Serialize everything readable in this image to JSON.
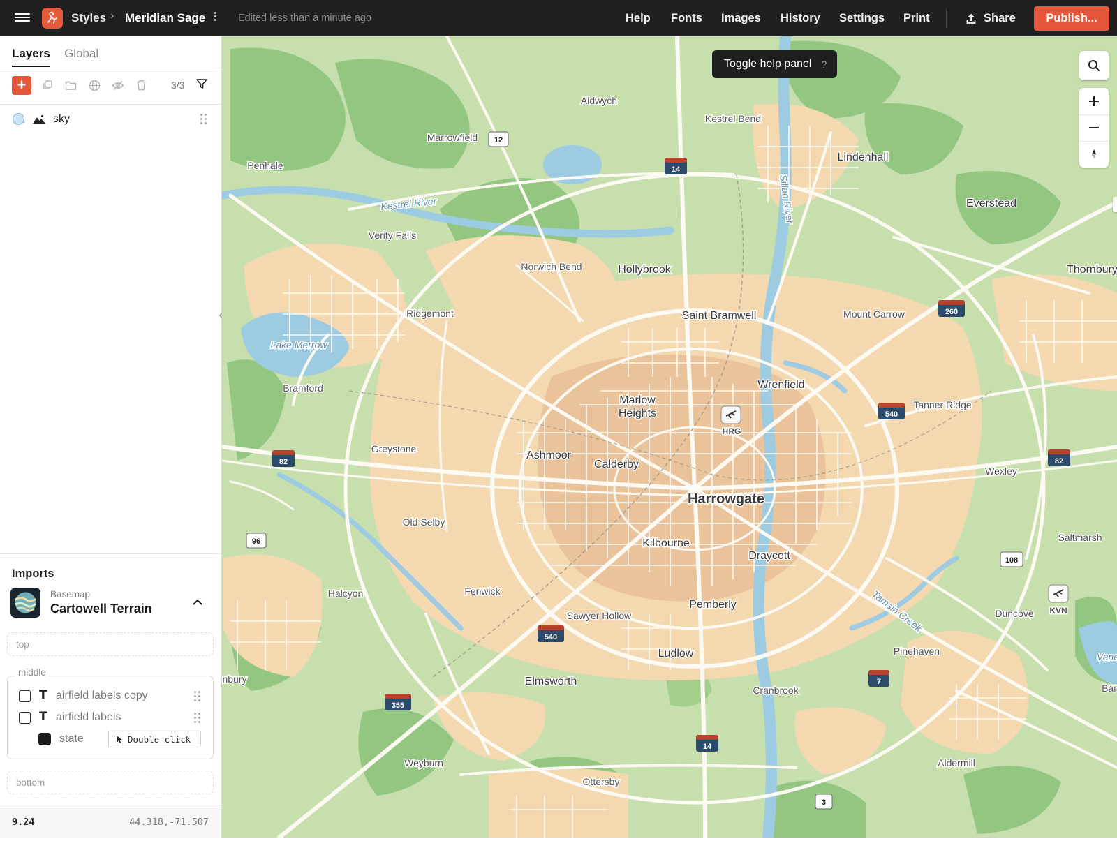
{
  "app": {
    "breadcrumb_root": "Styles",
    "style_name": "Meridian Sage",
    "edited_status": "Edited less than a minute ago",
    "accent_color": "#e4573a"
  },
  "nav": {
    "help": "Help",
    "fonts": "Fonts",
    "images": "Images",
    "history": "History",
    "settings": "Settings",
    "print": "Print",
    "share": "Share",
    "publish": "Publish..."
  },
  "sidebar": {
    "tabs": {
      "layers": "Layers",
      "global": "Global"
    },
    "active_tab": "Layers",
    "layer_count": "3/3",
    "layers": [
      {
        "name": "sky",
        "type_icon": "mountain-icon",
        "swatch_color": "#c8e4f4"
      }
    ],
    "imports": {
      "title": "Imports",
      "basemap_kicker": "Basemap",
      "basemap_name": "Cartowell Terrain",
      "slot_top": "top",
      "slot_middle": "middle",
      "slot_bottom": "bottom",
      "middle_layers": [
        {
          "name": "airfield labels copy",
          "type": "symbol"
        },
        {
          "name": "airfield labels",
          "type": "symbol"
        },
        {
          "name": "state",
          "type": "fill"
        }
      ],
      "double_click_hint": "Double click"
    },
    "footer": {
      "zoom": "9.24",
      "coordinates": "44.318,-71.507"
    }
  },
  "map": {
    "tooltip": "Toggle help panel",
    "tooltip_shortcut": "?",
    "colors": {
      "land": "#c7dfad",
      "forest": "#8fc47c",
      "urban": "#f4d8b0",
      "core": "#e8be92",
      "water": "#9ccbe2",
      "road": "#ffffff"
    },
    "place_labels": {
      "harrowgate": "Harrowgate",
      "marlow_heights_1": "Marlow",
      "marlow_heights_2": "Heights",
      "saint_bramwell": "Saint Bramwell",
      "wrenfield": "Wrenfield",
      "ashmoor": "Ashmoor",
      "calderby": "Calderby",
      "kilbourne": "Kilbourne",
      "draycott": "Draycott",
      "pemberly": "Pemberly",
      "ludlow": "Ludlow",
      "elmsworth": "Elmsworth",
      "hollybrook": "Hollybrook",
      "lindenhall": "Lindenhall",
      "everstead": "Everstead",
      "thornbury": "Thornbury",
      "aldwych": "Aldwych",
      "kestrel_bend": "Kestrel Bend",
      "marrowfield": "Marrowfield",
      "penhale": "Penhale",
      "verity_falls": "Verity Falls",
      "norwich_bend": "Norwich Bend",
      "ridgemont": "Ridgemont",
      "mount_carrow": "Mount Carrow",
      "lake_merrow": "Lake Merrow",
      "bramford": "Bramford",
      "tanner_ridge": "Tanner Ridge",
      "greystone": "Greystone",
      "wexley": "Wexley",
      "old_selby": "Old Selby",
      "saltmarsh": "Saltmarsh",
      "halcyon": "Halcyon",
      "fenwick": "Fenwick",
      "sawyer_hollow": "Sawyer Hollow",
      "duncove": "Duncove",
      "pinehaven": "Pinehaven",
      "cranbrook": "Cranbrook",
      "weyburn": "Weyburn",
      "ottersby": "Ottersby",
      "aldermill": "Aldermill",
      "vane": "Vane",
      "bar": "Bar",
      "nbury": "nbury",
      "kestrel_river": "Kestrel River",
      "sillan_river": "Sillan River",
      "tamsin_creek": "Tamsin Creek",
      "hrg": "HRG",
      "kvn": "KVN"
    },
    "shields": {
      "s12": "12",
      "s14a": "14",
      "s260": "260",
      "s540a": "540",
      "s82a": "82",
      "s82b": "82",
      "s96": "96",
      "s108": "108",
      "s540b": "540",
      "s355": "355",
      "s7": "7",
      "s14b": "14",
      "s3": "3"
    }
  }
}
